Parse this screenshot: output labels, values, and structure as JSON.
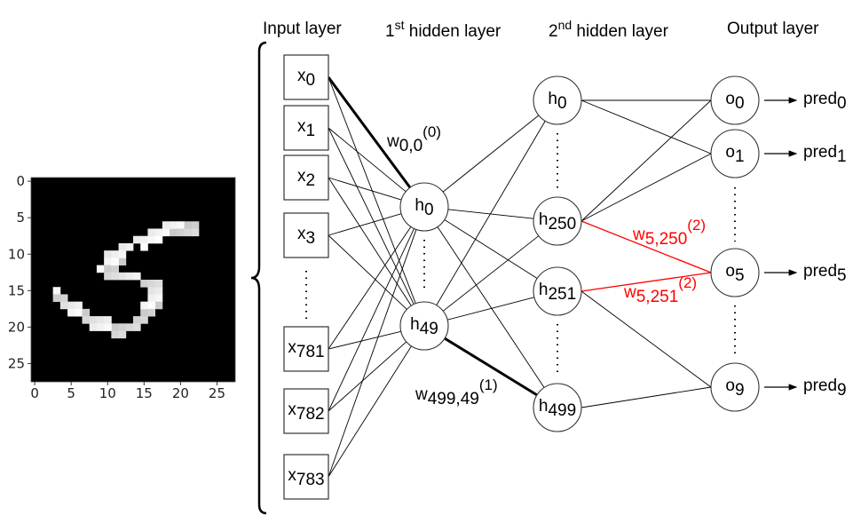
{
  "headers": {
    "input": "Input layer",
    "hidden1_num": "1",
    "hidden1_sup": "st",
    "hidden1_rest": " hidden layer",
    "hidden2_num": "2",
    "hidden2_sup": "nd",
    "hidden2_rest": " hidden layer",
    "output": "Output layer"
  },
  "input_nodes": [
    {
      "base": "x",
      "sub": "0"
    },
    {
      "base": "x",
      "sub": "1"
    },
    {
      "base": "x",
      "sub": "2"
    },
    {
      "base": "x",
      "sub": "3"
    },
    {
      "base": "x",
      "sub": "781"
    },
    {
      "base": "x",
      "sub": "782"
    },
    {
      "base": "x",
      "sub": "783"
    }
  ],
  "hidden1_nodes": [
    {
      "base": "h",
      "sub": "0"
    },
    {
      "base": "h",
      "sub": "49"
    }
  ],
  "hidden2_nodes": [
    {
      "base": "h",
      "sub": "0"
    },
    {
      "base": "h",
      "sub": "250"
    },
    {
      "base": "h",
      "sub": "251"
    },
    {
      "base": "h",
      "sub": "499"
    }
  ],
  "output_nodes": [
    {
      "base": "o",
      "sub": "0",
      "pred": "pred",
      "pred_sub": "0"
    },
    {
      "base": "o",
      "sub": "1",
      "pred": "pred",
      "pred_sub": "1"
    },
    {
      "base": "o",
      "sub": "5",
      "pred": "pred",
      "pred_sub": "5"
    },
    {
      "base": "o",
      "sub": "9",
      "pred": "pred",
      "pred_sub": "9"
    }
  ],
  "weight_labels": [
    {
      "base": "w",
      "sub": "0,0",
      "sup": "(0)",
      "color": "#000000"
    },
    {
      "base": "w",
      "sub": "499,49",
      "sup": "(1)",
      "color": "#000000"
    },
    {
      "base": "w",
      "sub": "5,250",
      "sup": "(2)",
      "color": "#ff0000"
    },
    {
      "base": "w",
      "sub": "5,251",
      "sup": "(2)",
      "color": "#ff0000"
    }
  ],
  "edges": {
    "input_to_h1": [
      [
        0,
        0,
        "bold"
      ],
      [
        0,
        1,
        "thin"
      ],
      [
        1,
        0,
        "thin"
      ],
      [
        1,
        1,
        "thin"
      ],
      [
        2,
        0,
        "thin"
      ],
      [
        2,
        1,
        "thin"
      ],
      [
        3,
        0,
        "thin"
      ],
      [
        3,
        1,
        "thin"
      ],
      [
        4,
        0,
        "thin"
      ],
      [
        4,
        1,
        "thin"
      ],
      [
        5,
        0,
        "thin"
      ],
      [
        5,
        1,
        "thin"
      ],
      [
        6,
        0,
        "thin"
      ],
      [
        6,
        1,
        "thin"
      ]
    ],
    "h1_to_h2": [
      [
        0,
        0,
        "thin"
      ],
      [
        0,
        1,
        "thin"
      ],
      [
        0,
        2,
        "thin"
      ],
      [
        0,
        3,
        "thin"
      ],
      [
        1,
        0,
        "thin"
      ],
      [
        1,
        1,
        "thin"
      ],
      [
        1,
        2,
        "thin"
      ],
      [
        1,
        3,
        "bold"
      ]
    ],
    "h2_to_out": [
      [
        0,
        0,
        "thin"
      ],
      [
        0,
        1,
        "thin"
      ],
      [
        1,
        0,
        "thin"
      ],
      [
        1,
        1,
        "thin"
      ],
      [
        1,
        2,
        "red"
      ],
      [
        2,
        2,
        "red"
      ],
      [
        2,
        3,
        "thin"
      ],
      [
        3,
        3,
        "thin"
      ]
    ]
  },
  "colors": {
    "highlight": "#ff0000",
    "line": "#000000",
    "node_stroke": "#333333"
  },
  "digit_image": {
    "description": "MNIST handwritten digit 5, 28x28 grayscale",
    "x_ticks": [
      "0",
      "5",
      "10",
      "15",
      "20",
      "25"
    ],
    "y_ticks": [
      "0",
      "5",
      "10",
      "15",
      "20",
      "25"
    ]
  }
}
